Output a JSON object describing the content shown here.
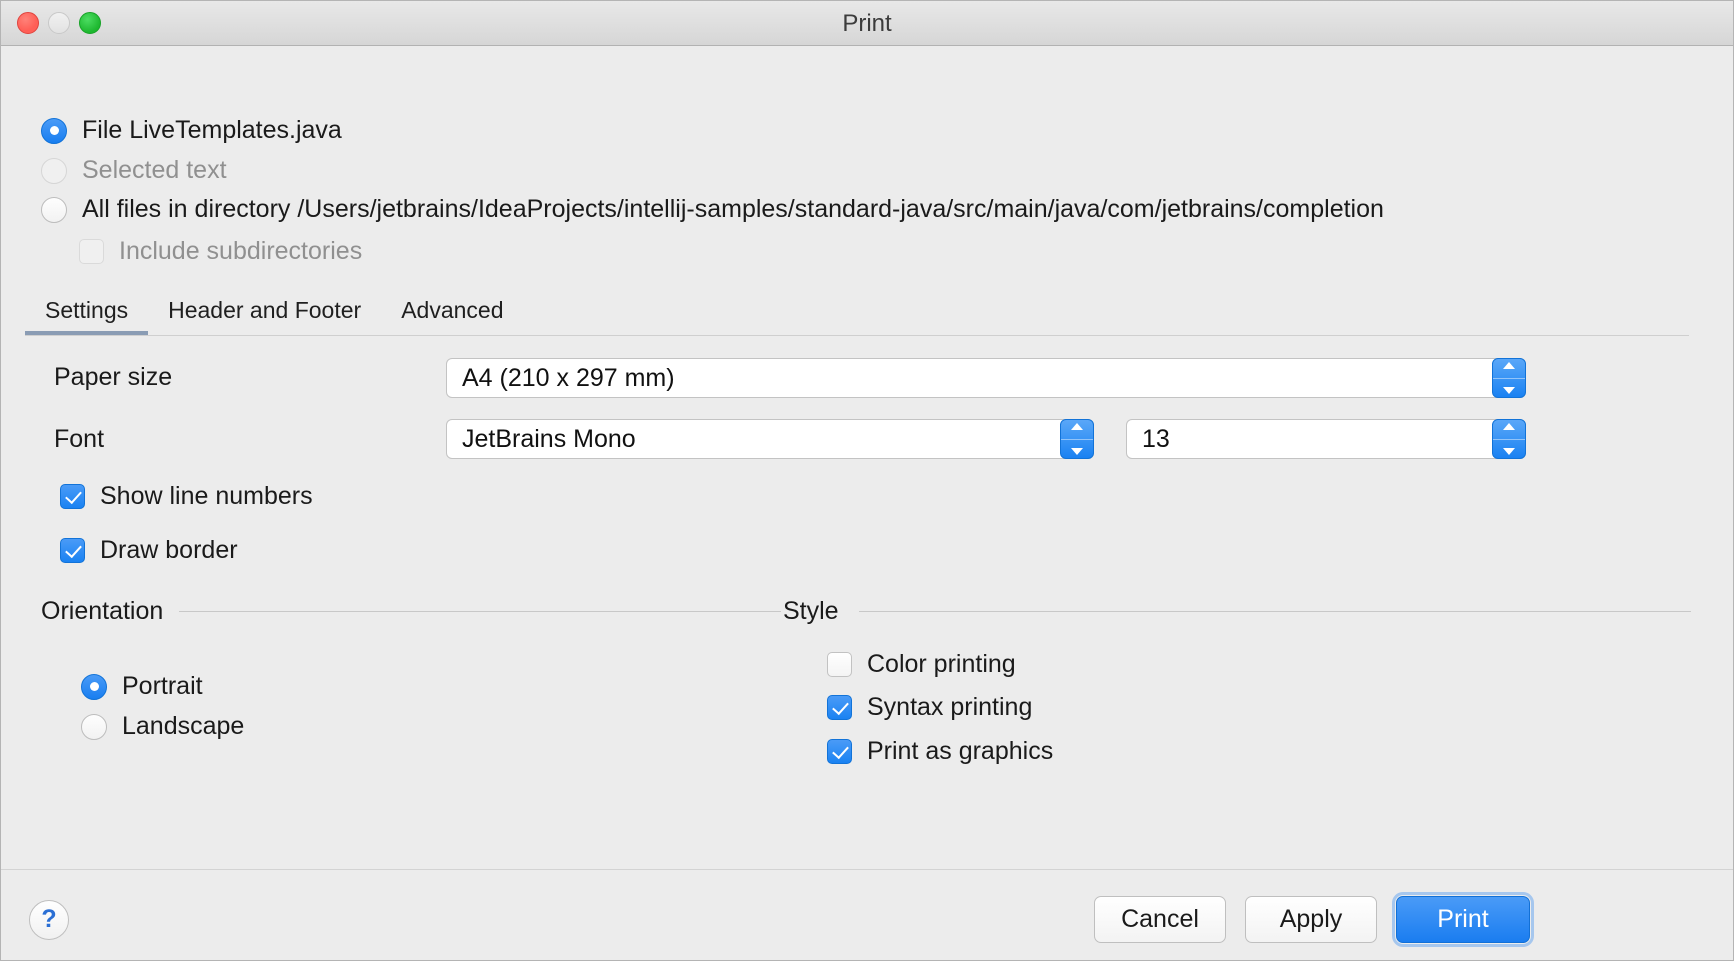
{
  "window": {
    "title": "Print",
    "traffic_lights": [
      "close-button",
      "minimize-button",
      "zoom-button"
    ]
  },
  "scope": {
    "options": [
      {
        "label": "File LiveTemplates.java",
        "selected": true,
        "disabled": false
      },
      {
        "label": "Selected text",
        "selected": false,
        "disabled": true
      },
      {
        "label": "All files in directory /Users/jetbrains/IdeaProjects/intellij-samples/standard-java/src/main/java/com/jetbrains/completion",
        "selected": false,
        "disabled": false
      }
    ],
    "include_subdirectories": {
      "label": "Include subdirectories",
      "checked": false,
      "disabled": true
    }
  },
  "tabs": [
    {
      "label": "Settings",
      "active": true
    },
    {
      "label": "Header and Footer",
      "active": false
    },
    {
      "label": "Advanced",
      "active": false
    }
  ],
  "settings": {
    "paper_size": {
      "label": "Paper size",
      "value": "A4    (210 x 297 mm)"
    },
    "font": {
      "label": "Font",
      "value": "JetBrains Mono"
    },
    "font_size": {
      "value": "13"
    },
    "show_line_numbers": {
      "label": "Show line numbers",
      "checked": true
    },
    "draw_border": {
      "label": "Draw border",
      "checked": true
    }
  },
  "orientation": {
    "title": "Orientation",
    "options": [
      {
        "label": "Portrait",
        "selected": true
      },
      {
        "label": "Landscape",
        "selected": false
      }
    ]
  },
  "style": {
    "title": "Style",
    "options": [
      {
        "label": "Color printing",
        "checked": false
      },
      {
        "label": "Syntax printing",
        "checked": true
      },
      {
        "label": "Print as graphics",
        "checked": true
      }
    ]
  },
  "footer": {
    "help_label": "?",
    "cancel_label": "Cancel",
    "apply_label": "Apply",
    "print_label": "Print"
  },
  "colors": {
    "accent": "#1a82f2",
    "tab_underline": "#8a9cb4",
    "window_bg": "#ececec",
    "disabled_text": "#909090"
  }
}
